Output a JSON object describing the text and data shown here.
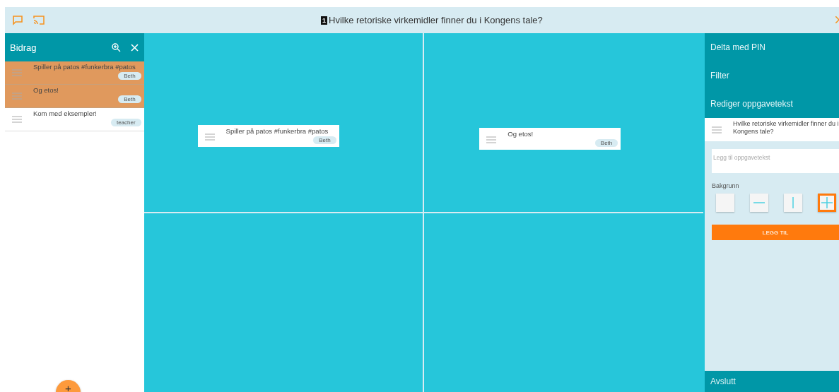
{
  "header": {
    "number": "1",
    "title": "Hvilke retoriske virkemidler finner du i Kongens tale?"
  },
  "sidebar": {
    "title": "Bidrag",
    "items": [
      {
        "text": "Spiller på patos #funkerbra #patos",
        "author": "Beth",
        "selected": true
      },
      {
        "text": "Og etos!",
        "author": "Beth",
        "selected": true
      },
      {
        "text": "Kom med eksempler!",
        "author": "teacher",
        "selected": false
      }
    ],
    "add_button": "+"
  },
  "canvas": {
    "quadrants": [
      {
        "cards": [
          {
            "text": "Spiller på patos #funkerbra #patos",
            "author": "Beth"
          }
        ]
      },
      {
        "cards": [
          {
            "text": "Og etos!",
            "author": "Beth"
          }
        ]
      }
    ]
  },
  "right_panel": {
    "menu": [
      "Delta med PIN",
      "Filter",
      "Rediger oppgavetekst"
    ],
    "task_text": "Hvilke retoriske virkemidler finner du i Kongens tale?",
    "text_field": {
      "placeholder": "Legg til oppgavetekst"
    },
    "background_label": "Bakgrunn",
    "backgrounds": [
      {
        "kind": "none",
        "selected": false
      },
      {
        "kind": "horizontal",
        "selected": false
      },
      {
        "kind": "vertical",
        "selected": false
      },
      {
        "kind": "cross",
        "selected": true
      }
    ],
    "add_button": "LEGG TIL",
    "exit": "Avslutt"
  }
}
